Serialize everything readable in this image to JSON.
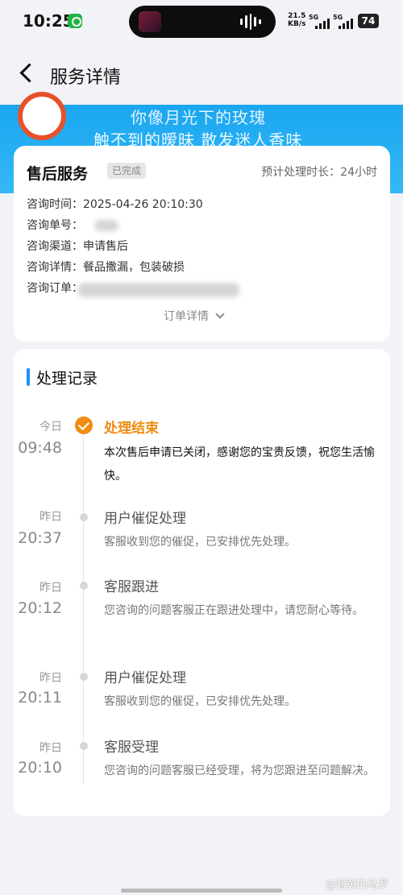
{
  "status_bar": {
    "time": "10:25",
    "net_speed": "21.5",
    "net_unit": "KB/s",
    "sig1": "5G",
    "sig2": "5G",
    "battery": "74"
  },
  "nav": {
    "title": "服务详情",
    "back_icon": "chevron-left-icon"
  },
  "banner": {
    "line1": "你像月光下的玫瑰",
    "line2": "触不到的暧昧 散发迷人香味"
  },
  "service": {
    "title": "售后服务",
    "status": "已完成",
    "eta": "预计处理时长：24小时",
    "fields": [
      {
        "label": "咨询时间：",
        "value": "2025-04-26 20:10:30"
      },
      {
        "label": "咨询单号：",
        "value": ""
      },
      {
        "label": "咨询渠道：",
        "value": "申请售后"
      },
      {
        "label": "咨询详情：",
        "value": "餐品撒漏，包装破损"
      },
      {
        "label": "咨询订单：",
        "value": ""
      }
    ],
    "order_details": "订单详情"
  },
  "records": {
    "title": "处理记录",
    "items": [
      {
        "day": "今日",
        "time": "09:48",
        "title": "处理结束",
        "desc": "本次售后申请已关闭，感谢您的宝贵反馈，祝您生活愉快。",
        "active": true
      },
      {
        "day": "昨日",
        "time": "20:37",
        "title": "用户催促处理",
        "desc": "客服收到您的催促，已安排优先处理。",
        "active": false
      },
      {
        "day": "昨日",
        "time": "20:12",
        "title": "客服跟进",
        "desc": "您咨询的问题客服正在跟进处理中，请您耐心等待。",
        "active": false
      },
      {
        "day": "昨日",
        "time": "20:11",
        "title": "用户催促处理",
        "desc": "客服收到您的催促，已安排优先处理。",
        "active": false
      },
      {
        "day": "昨日",
        "time": "20:10",
        "title": "客服受理",
        "desc": "您咨询的问题客服已经受理，将为您跟进至问题解决。",
        "active": false
      }
    ]
  },
  "watermark": "@碧黄的马罗",
  "colors": {
    "accent": "#f08c12",
    "blue": "#1e90ff",
    "banner": "#1aa6f0"
  }
}
